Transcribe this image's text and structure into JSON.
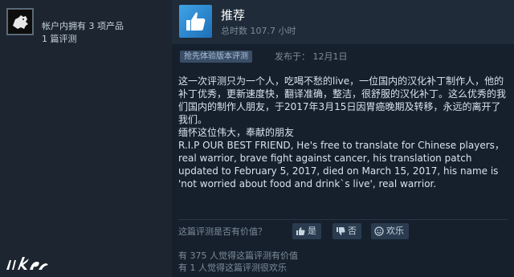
{
  "reviewer": {
    "products_owned": "帐户内拥有 3 项产品",
    "review_count": "1 篇评测"
  },
  "review": {
    "verdict": "推荐",
    "hours": "总时数 107.7 小时",
    "early_access_badge": "抢先体验版本评测",
    "posted": "发布于：  12月1日",
    "body": [
      "这一次评测只为一个人，吃喝不愁的live，一位国内的汉化补丁制作人，他的补丁优秀，更新速度快，翻译准确，整洁，很舒服的汉化补丁。这么优秀的我们国内的制作人朋友，于2017年3月15日因胃癌晚期及转移，永远的离开了我们。",
      "缅怀这位伟大，奉献的朋友",
      "R.I.P OUR BEST FRIEND, He's free to translate for Chinese players，real warrior, brave fight against cancer, his translation patch updated to February 5, 2017, died on March 15, 2017, his name is 'not worried about food and drink`s live', real warrior."
    ]
  },
  "helpful": {
    "question": "这篇评测是否有价值？",
    "yes_label": "是",
    "no_label": "否",
    "funny_label": "欢乐",
    "stat_helpful": "有 375 人觉得这篇评测有价值",
    "stat_funny": "有 1 人觉得这篇评测很欢乐"
  },
  "icons": {
    "avatar": "avatar-lion",
    "verdict": "thumbs-up-icon",
    "yes": "thumbs-up-icon",
    "no": "thumbs-down-icon",
    "funny": "smiley-icon"
  },
  "colors": {
    "accent_blue": "#3fa3e6",
    "background": "#16202d"
  }
}
